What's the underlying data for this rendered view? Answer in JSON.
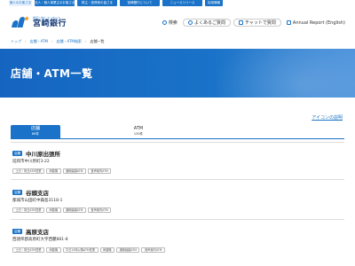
{
  "topnav": {
    "tabs": [
      "個人のお客さま",
      "法人・個人事業主のお客さま",
      "株主・投資家の皆さま",
      "宮崎銀行について",
      "ニュースリリース",
      "採用情報"
    ]
  },
  "header": {
    "logo_sub": "地元と共に エッセンス",
    "logo_name": "宮崎銀行",
    "links": [
      "検索",
      "よくあるご質問",
      "チャットで質問",
      "Annual Report (English)"
    ]
  },
  "breadcrumb": [
    "トップ",
    "店舗・ATM",
    "店舗・ATM検索",
    "店舗一覧"
  ],
  "hero": {
    "title": "店舗・ATM一覧"
  },
  "icon_note": "アイコンの説明",
  "tabs": [
    {
      "label": "店舗",
      "count": "86件",
      "active": true
    },
    {
      "label": "ATM",
      "count": "130件",
      "active": false
    }
  ],
  "stores": [
    {
      "badge": "店舗",
      "name": "中川原出張所",
      "address": "延岡市中川原町3-22",
      "chips": [
        "土日・祝日ATM営業",
        "両替機",
        "通帳繰越ATM",
        "音声案内ATM"
      ]
    },
    {
      "badge": "店舗",
      "name": "谷頭支店",
      "address": "都城市山田町中霧島3118-1",
      "chips": [
        "土日・祝日ATM営業",
        "両替機",
        "通帳繰越ATM",
        "音声案内ATM"
      ]
    },
    {
      "badge": "店舗",
      "name": "高原支店",
      "address": "西諸県郡高原町大字西麓881-8",
      "chips": [
        "土日・祝日ATM営業",
        "両替機",
        "平日15時以降ATM営業",
        "両替機",
        "通帳繰越ATM",
        "音声案内ATM"
      ]
    }
  ]
}
